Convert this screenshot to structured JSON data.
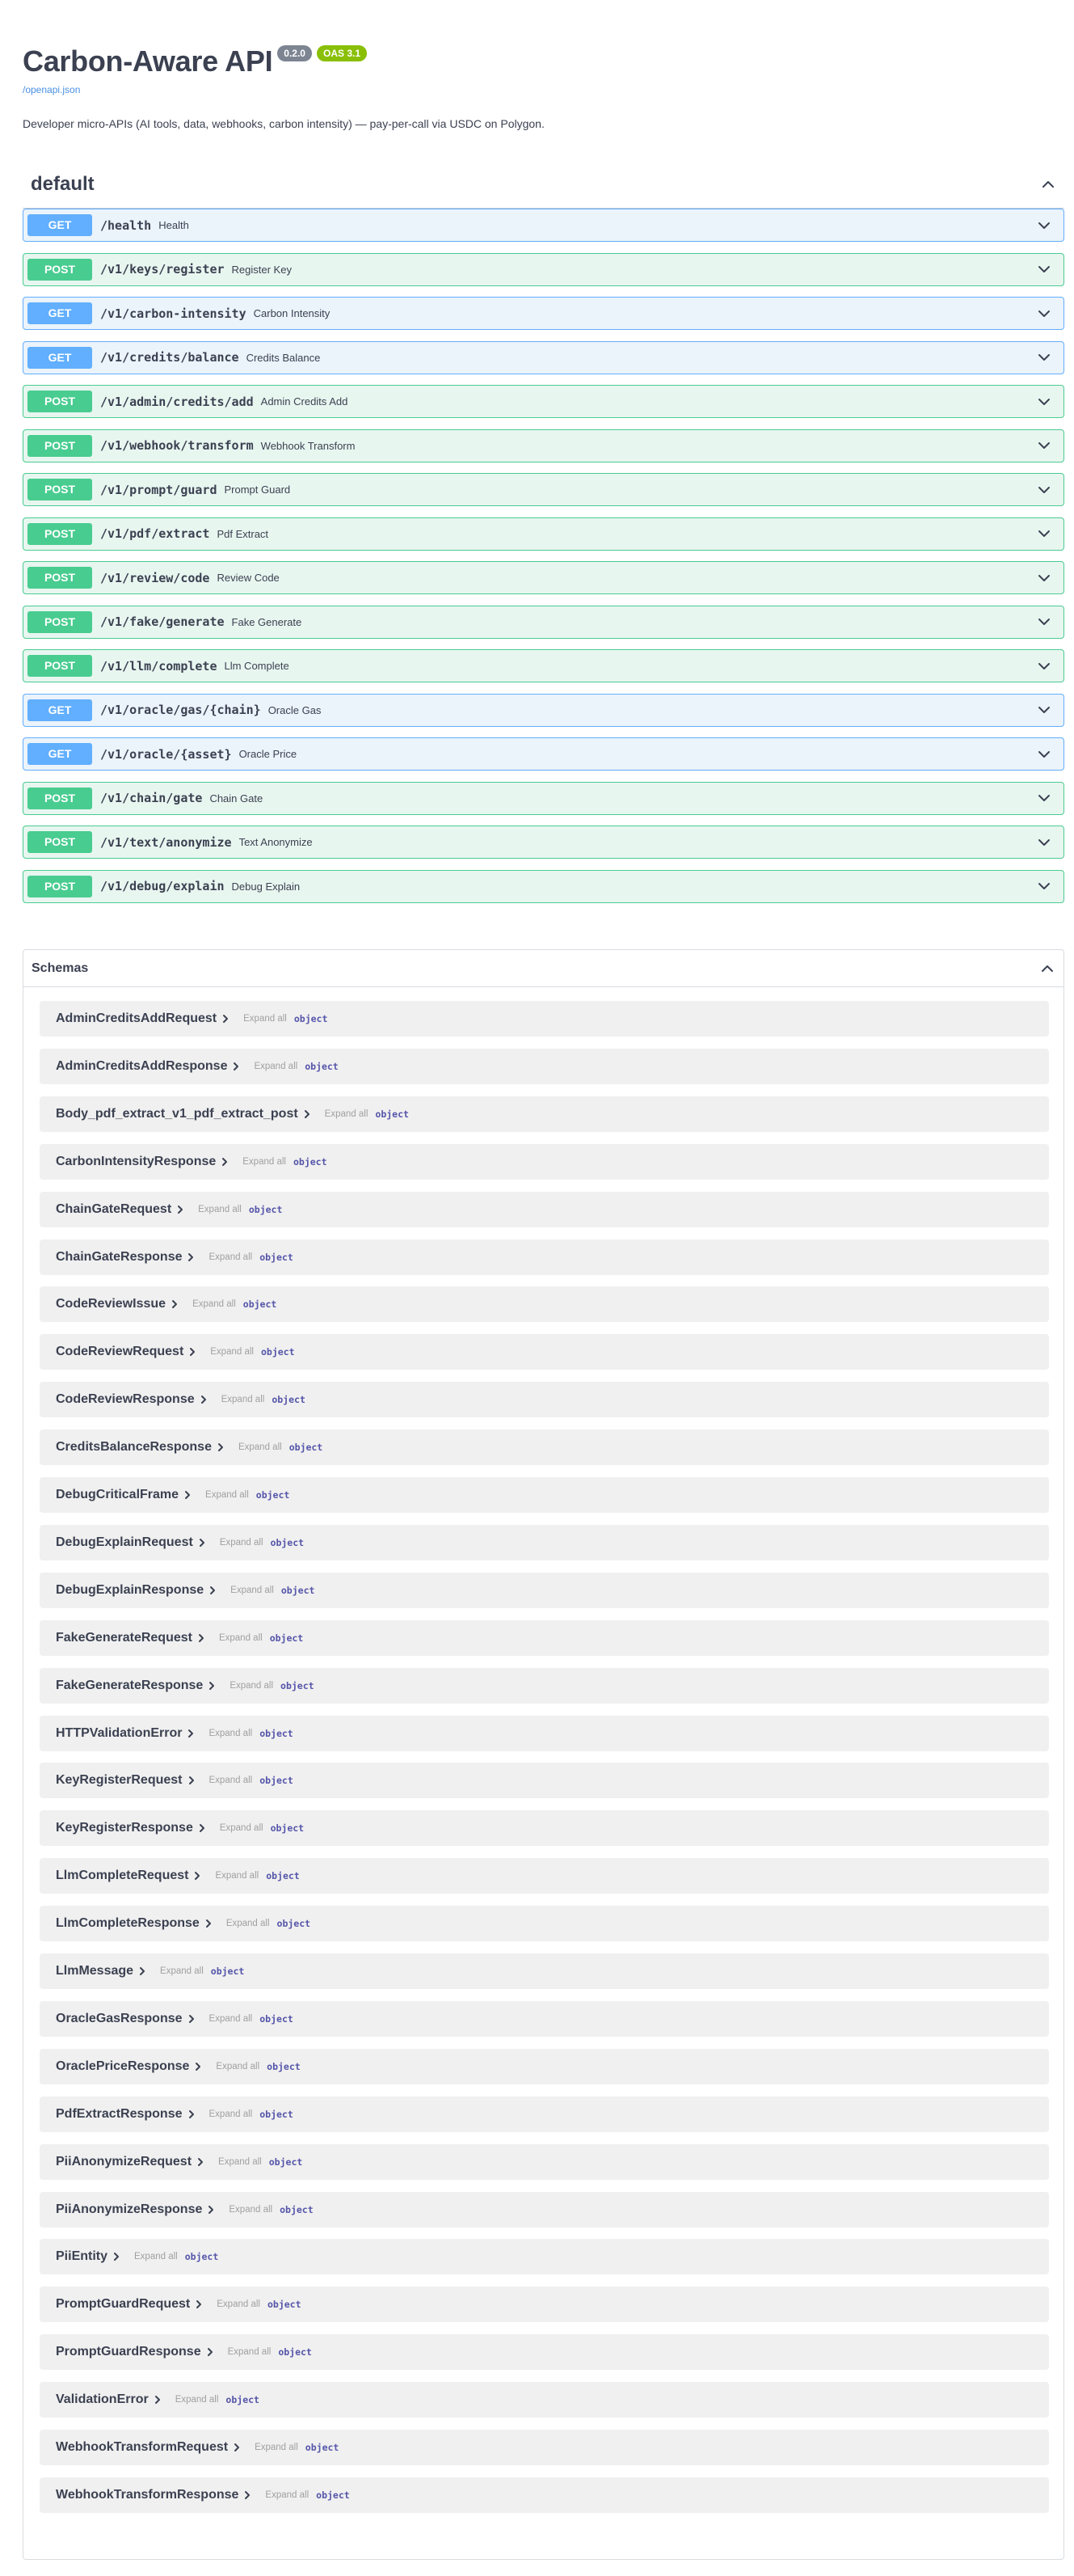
{
  "info": {
    "title": "Carbon-Aware API",
    "version": "0.2.0",
    "oas": "OAS 3.1",
    "spec_link": "/openapi.json",
    "description": "Developer micro-APIs (AI tools, data, webhooks, carbon intensity) — pay-per-call via USDC on Polygon."
  },
  "tag": {
    "name": "default"
  },
  "operations": [
    {
      "method": "GET",
      "path": "/health",
      "summary": "Health"
    },
    {
      "method": "POST",
      "path": "/v1/keys/register",
      "summary": "Register Key"
    },
    {
      "method": "GET",
      "path": "/v1/carbon-intensity",
      "summary": "Carbon Intensity"
    },
    {
      "method": "GET",
      "path": "/v1/credits/balance",
      "summary": "Credits Balance"
    },
    {
      "method": "POST",
      "path": "/v1/admin/credits/add",
      "summary": "Admin Credits Add"
    },
    {
      "method": "POST",
      "path": "/v1/webhook/transform",
      "summary": "Webhook Transform"
    },
    {
      "method": "POST",
      "path": "/v1/prompt/guard",
      "summary": "Prompt Guard"
    },
    {
      "method": "POST",
      "path": "/v1/pdf/extract",
      "summary": "Pdf Extract"
    },
    {
      "method": "POST",
      "path": "/v1/review/code",
      "summary": "Review Code"
    },
    {
      "method": "POST",
      "path": "/v1/fake/generate",
      "summary": "Fake Generate"
    },
    {
      "method": "POST",
      "path": "/v1/llm/complete",
      "summary": "Llm Complete"
    },
    {
      "method": "GET",
      "path": "/v1/oracle/gas/{chain}",
      "summary": "Oracle Gas"
    },
    {
      "method": "GET",
      "path": "/v1/oracle/{asset}",
      "summary": "Oracle Price"
    },
    {
      "method": "POST",
      "path": "/v1/chain/gate",
      "summary": "Chain Gate"
    },
    {
      "method": "POST",
      "path": "/v1/text/anonymize",
      "summary": "Text Anonymize"
    },
    {
      "method": "POST",
      "path": "/v1/debug/explain",
      "summary": "Debug Explain"
    }
  ],
  "schemas": {
    "title": "Schemas",
    "expand_label": "Expand all",
    "type_label": "object",
    "items": [
      "AdminCreditsAddRequest",
      "AdminCreditsAddResponse",
      "Body_pdf_extract_v1_pdf_extract_post",
      "CarbonIntensityResponse",
      "ChainGateRequest",
      "ChainGateResponse",
      "CodeReviewIssue",
      "CodeReviewRequest",
      "CodeReviewResponse",
      "CreditsBalanceResponse",
      "DebugCriticalFrame",
      "DebugExplainRequest",
      "DebugExplainResponse",
      "FakeGenerateRequest",
      "FakeGenerateResponse",
      "HTTPValidationError",
      "KeyRegisterRequest",
      "KeyRegisterResponse",
      "LlmCompleteRequest",
      "LlmCompleteResponse",
      "LlmMessage",
      "OracleGasResponse",
      "OraclePriceResponse",
      "PdfExtractResponse",
      "PiiAnonymizeRequest",
      "PiiAnonymizeResponse",
      "PiiEntity",
      "PromptGuardRequest",
      "PromptGuardResponse",
      "ValidationError",
      "WebhookTransformRequest",
      "WebhookTransformResponse"
    ]
  },
  "colors": {
    "get": "#61affe",
    "post": "#49cc90",
    "get_bg": "#ebf3fb",
    "post_bg": "#e8f6f0",
    "link": "#4990e2",
    "oas_badge": "#89bf04",
    "version_badge": "#7d8492"
  },
  "icons": {
    "collapse": "chevron-up-icon",
    "expand": "chevron-down-icon",
    "model_toggle": "chevron-right-icon"
  }
}
